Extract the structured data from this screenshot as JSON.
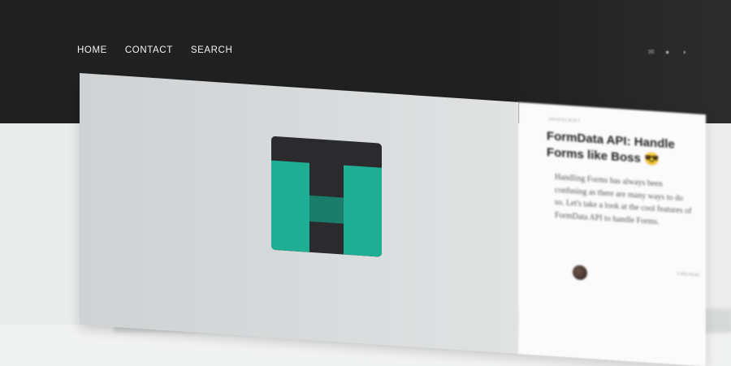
{
  "nav": {
    "items": [
      {
        "label": "HOME"
      },
      {
        "label": "CONTACT"
      },
      {
        "label": "SEARCH"
      }
    ]
  },
  "header_icons": [
    "mail-icon",
    "github-icon",
    "rss-icon"
  ],
  "post": {
    "category": "JAVASCRIPT",
    "title": "FormData API: Handle Forms like Boss 😎",
    "excerpt": "Handling Forms has always been confusing as there are many ways to do so. Let's take a look at the cool features of FormData API to handle Forms.",
    "read_time": "3 MIN READ"
  },
  "colors": {
    "header_bg": "#212121",
    "accent": "#1fae94",
    "logo_bg": "#2b2b2e"
  }
}
